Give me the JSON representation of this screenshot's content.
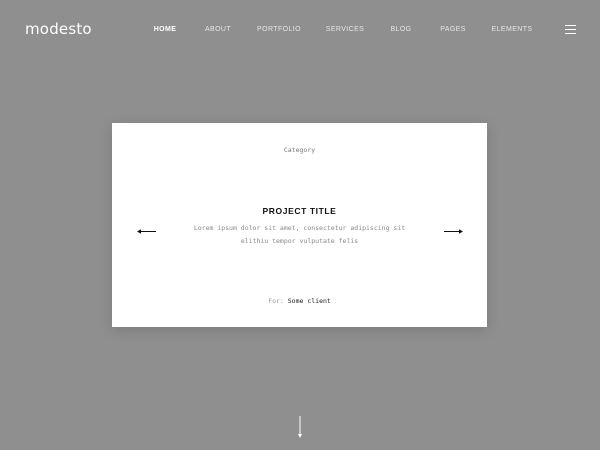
{
  "header": {
    "logo": "modesto",
    "nav": [
      {
        "label": "HOME",
        "active": true
      },
      {
        "label": "ABOUT",
        "active": false
      },
      {
        "label": "PORTFOLIO",
        "active": false
      },
      {
        "label": "SERVICES",
        "active": false
      },
      {
        "label": "BLOG",
        "active": false
      },
      {
        "label": "PAGES",
        "active": false
      },
      {
        "label": "ELEMENTS",
        "active": false
      }
    ],
    "menu_icon": "hamburger-menu-icon"
  },
  "slide": {
    "category": "Category",
    "title": "PROJECT TITLE",
    "description": "Lorem ipsum dolor sit amet, consectetur adipiscing sit elithiu tempor vulputate felis",
    "client_label": "For:",
    "client_name": "Some client",
    "prev_icon": "arrow-left-icon",
    "next_icon": "arrow-right-icon"
  },
  "scroll_icon": "arrow-down-icon",
  "colors": {
    "background": "#8f8f8f",
    "card": "#ffffff",
    "text_dark": "#111111",
    "text_muted": "#888888",
    "nav_text": "#ffffff"
  }
}
